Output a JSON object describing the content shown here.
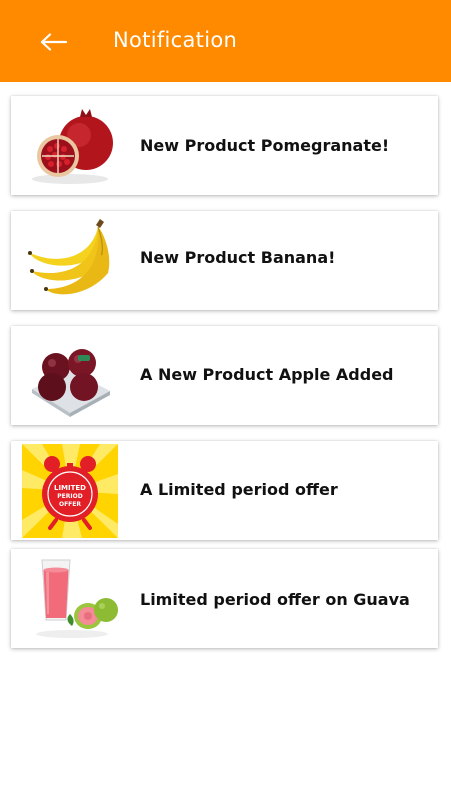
{
  "header": {
    "title": "Notification",
    "back_icon": "arrow-left-icon",
    "color": "#FF8A00"
  },
  "notifications": [
    {
      "text": "New Product Pomegranate!",
      "icon": "pomegranate-image"
    },
    {
      "text": "New Product Banana!",
      "icon": "banana-image"
    },
    {
      "text": "A New Product Apple Added",
      "icon": "apple-image"
    },
    {
      "text": "A Limited period offer",
      "icon": "limited-offer-clock-image",
      "badge_text": "LIMITED PERIOD OFFER"
    },
    {
      "text": "Limited period offer on Guava",
      "icon": "guava-juice-image"
    }
  ]
}
